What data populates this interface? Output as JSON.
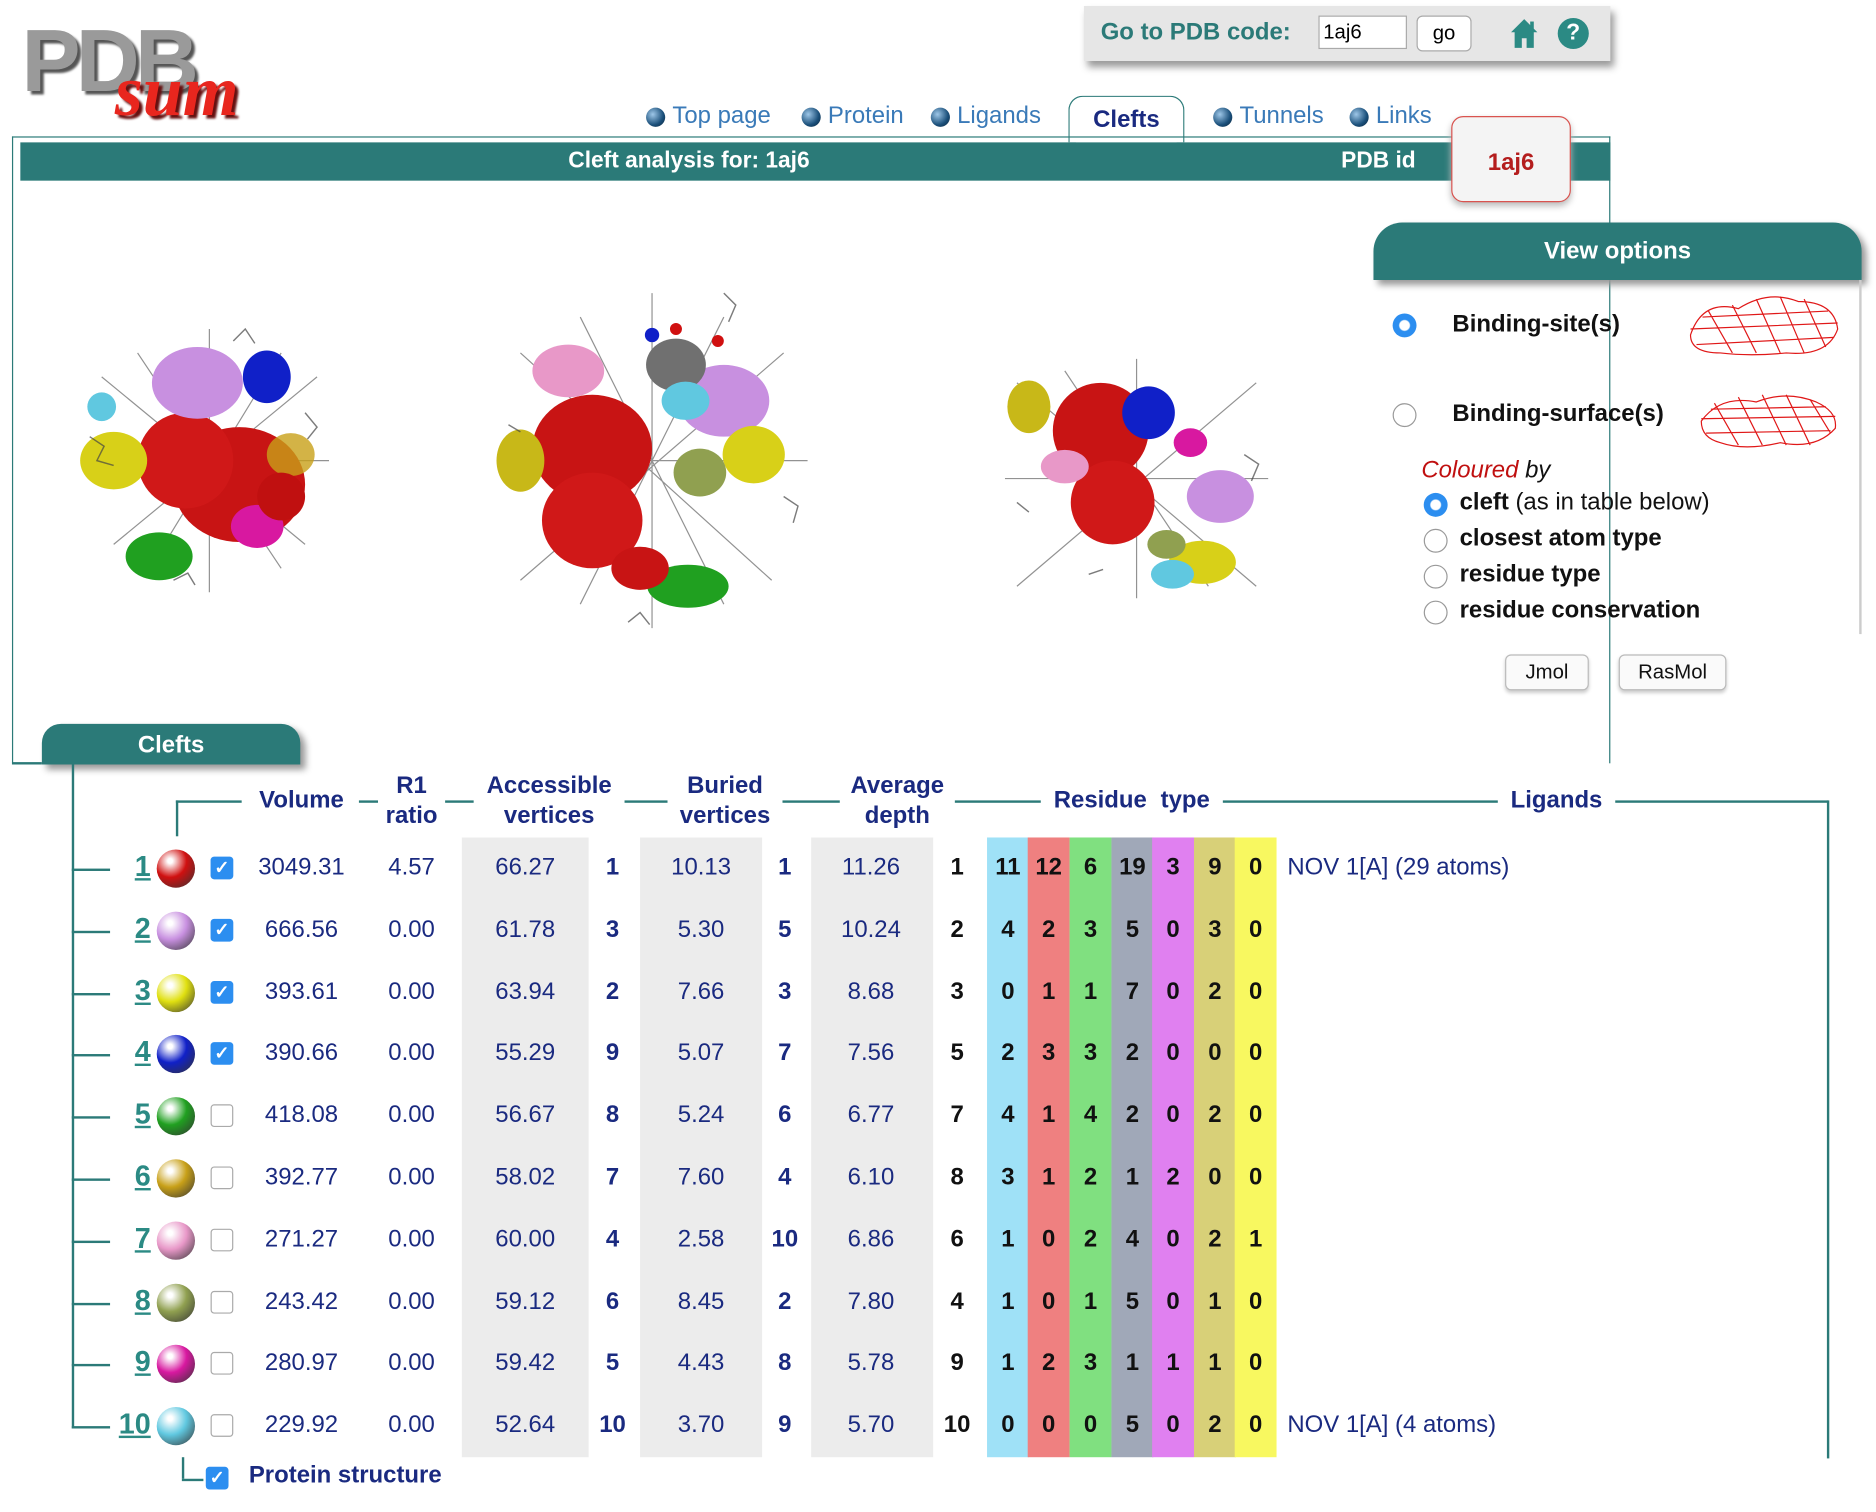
{
  "logo": {
    "pdb": "PDB",
    "sum": "sum"
  },
  "goto": {
    "label": "Go to PDB code:",
    "value": "1aj6",
    "button": "go"
  },
  "tabs": [
    {
      "label": "Top page",
      "active": false
    },
    {
      "label": "Protein",
      "active": false
    },
    {
      "label": "Ligands",
      "active": false
    },
    {
      "label": "Clefts",
      "active": true
    },
    {
      "label": "Tunnels",
      "active": false
    },
    {
      "label": "Links",
      "active": false
    }
  ],
  "header": {
    "title": "Cleft analysis for: 1aj6",
    "pdb_label": "PDB id",
    "pdb_id": "1aj6"
  },
  "view_options": {
    "title": "View options",
    "modes": [
      "Binding-site(s)",
      "Binding-surface(s)"
    ],
    "coloured_by_prefix": "Coloured",
    "coloured_by_suffix": " by",
    "colour_options": [
      {
        "bold": "cleft",
        "rest": " (as in table below)"
      },
      {
        "bold": "closest atom type",
        "rest": ""
      },
      {
        "bold": "residue type",
        "rest": ""
      },
      {
        "bold": "residue conservation",
        "rest": ""
      }
    ],
    "buttons": [
      "Jmol",
      "RasMol"
    ]
  },
  "clefts": {
    "title": "Clefts",
    "headers": {
      "volume": "Volume",
      "r1a": "R1",
      "r1b": "ratio",
      "acc_a": "Accessible",
      "acc_b": "vertices",
      "bur_a": "Buried",
      "bur_b": "vertices",
      "dep_a": "Average",
      "dep_b": "depth",
      "res_a": "Residue",
      "res_b": "type",
      "ligands": "Ligands"
    },
    "rows": [
      {
        "n": "1",
        "color": "#d01010",
        "checked": true,
        "volume": "3049.31",
        "r1": "4.57",
        "acc": "66.27",
        "acc_rank": "1",
        "bur": "10.13",
        "bur_rank": "1",
        "depth": "11.26",
        "depth_rank": "1",
        "res": [
          "11",
          "12",
          "6",
          "19",
          "3",
          "9",
          "0"
        ],
        "ligand": "NOV 1[A] (29 atoms)"
      },
      {
        "n": "2",
        "color": "#c890e0",
        "checked": true,
        "volume": "666.56",
        "r1": "0.00",
        "acc": "61.78",
        "acc_rank": "3",
        "bur": "5.30",
        "bur_rank": "5",
        "depth": "10.24",
        "depth_rank": "2",
        "res": [
          "4",
          "2",
          "3",
          "5",
          "0",
          "3",
          "0"
        ],
        "ligand": ""
      },
      {
        "n": "3",
        "color": "#e0e010",
        "checked": true,
        "volume": "393.61",
        "r1": "0.00",
        "acc": "63.94",
        "acc_rank": "2",
        "bur": "7.66",
        "bur_rank": "3",
        "depth": "8.68",
        "depth_rank": "3",
        "res": [
          "0",
          "1",
          "1",
          "7",
          "0",
          "2",
          "0"
        ],
        "ligand": ""
      },
      {
        "n": "4",
        "color": "#1020c8",
        "checked": true,
        "volume": "390.66",
        "r1": "0.00",
        "acc": "55.29",
        "acc_rank": "9",
        "bur": "5.07",
        "bur_rank": "7",
        "depth": "7.56",
        "depth_rank": "5",
        "res": [
          "2",
          "3",
          "3",
          "2",
          "0",
          "0",
          "0"
        ],
        "ligand": ""
      },
      {
        "n": "5",
        "color": "#20a020",
        "checked": false,
        "volume": "418.08",
        "r1": "0.00",
        "acc": "56.67",
        "acc_rank": "8",
        "bur": "5.24",
        "bur_rank": "6",
        "depth": "6.77",
        "depth_rank": "7",
        "res": [
          "4",
          "1",
          "4",
          "2",
          "0",
          "2",
          "0"
        ],
        "ligand": ""
      },
      {
        "n": "6",
        "color": "#c8a018",
        "checked": false,
        "volume": "392.77",
        "r1": "0.00",
        "acc": "58.02",
        "acc_rank": "7",
        "bur": "7.60",
        "bur_rank": "4",
        "depth": "6.10",
        "depth_rank": "8",
        "res": [
          "3",
          "1",
          "2",
          "1",
          "2",
          "0",
          "0"
        ],
        "ligand": ""
      },
      {
        "n": "7",
        "color": "#e898c8",
        "checked": false,
        "volume": "271.27",
        "r1": "0.00",
        "acc": "60.00",
        "acc_rank": "4",
        "bur": "2.58",
        "bur_rank": "10",
        "depth": "6.86",
        "depth_rank": "6",
        "res": [
          "1",
          "0",
          "2",
          "4",
          "0",
          "2",
          "1"
        ],
        "ligand": ""
      },
      {
        "n": "8",
        "color": "#90a050",
        "checked": false,
        "volume": "243.42",
        "r1": "0.00",
        "acc": "59.12",
        "acc_rank": "6",
        "bur": "8.45",
        "bur_rank": "2",
        "depth": "7.80",
        "depth_rank": "4",
        "res": [
          "1",
          "0",
          "1",
          "5",
          "0",
          "1",
          "0"
        ],
        "ligand": ""
      },
      {
        "n": "9",
        "color": "#d818a0",
        "checked": false,
        "volume": "280.97",
        "r1": "0.00",
        "acc": "59.42",
        "acc_rank": "5",
        "bur": "4.43",
        "bur_rank": "8",
        "depth": "5.78",
        "depth_rank": "9",
        "res": [
          "1",
          "2",
          "3",
          "1",
          "1",
          "1",
          "0"
        ],
        "ligand": ""
      },
      {
        "n": "10",
        "color": "#60c8e0",
        "checked": false,
        "volume": "229.92",
        "r1": "0.00",
        "acc": "52.64",
        "acc_rank": "10",
        "bur": "3.70",
        "bur_rank": "9",
        "depth": "5.70",
        "depth_rank": "10",
        "res": [
          "0",
          "0",
          "0",
          "5",
          "0",
          "2",
          "0"
        ],
        "ligand": "NOV 1[A] (4 atoms)"
      }
    ],
    "residue_colors": [
      "#9fe1f7",
      "#ef8080",
      "#80e080",
      "#a0a8b8",
      "#e080f0",
      "#d8d078",
      "#f8f860"
    ],
    "protein_structure": {
      "label": "Protein structure",
      "checked": true
    }
  }
}
